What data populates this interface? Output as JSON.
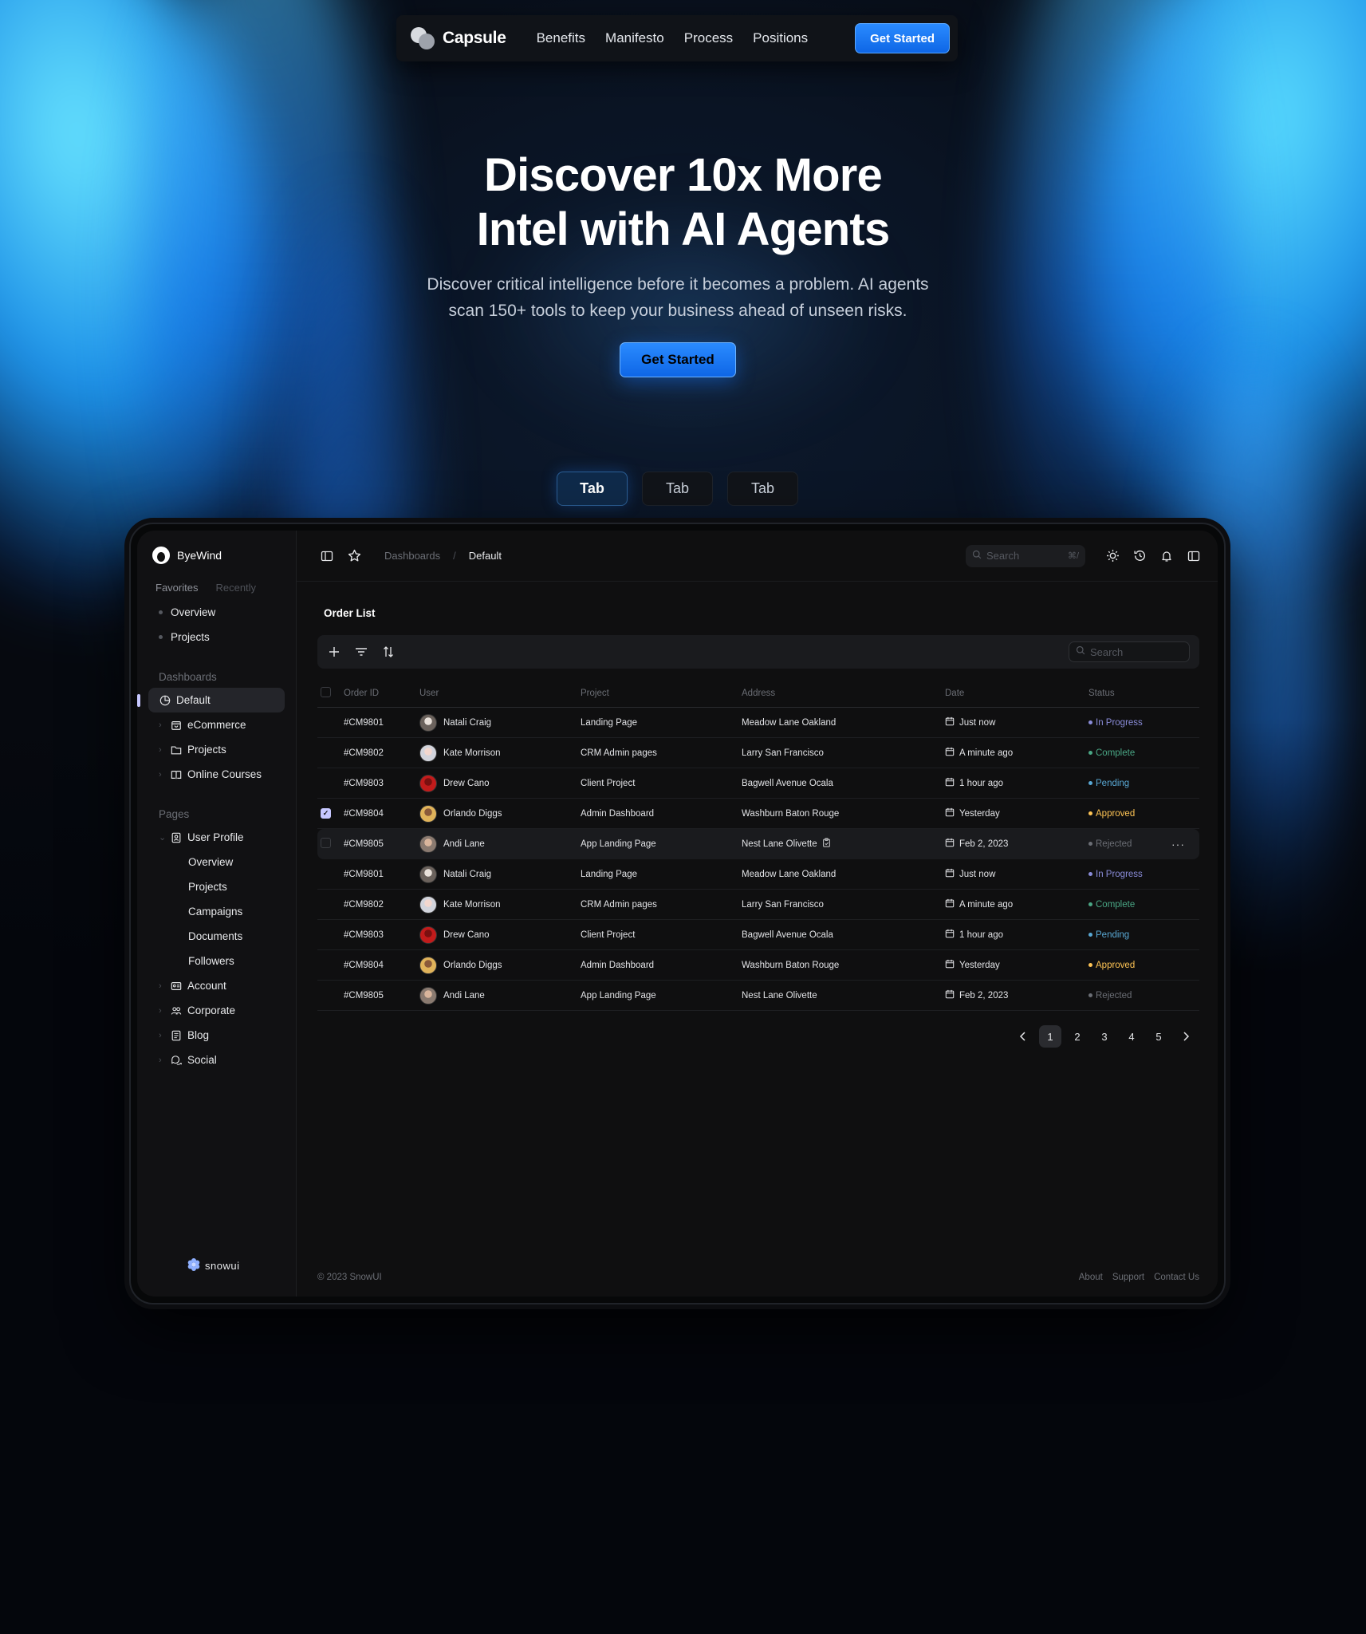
{
  "nav": {
    "brand": "Capsule",
    "links": [
      "Benefits",
      "Manifesto",
      "Process",
      "Positions"
    ],
    "cta": "Get Started"
  },
  "hero": {
    "title_line1": "Discover 10x More",
    "title_line2": "Intel with AI Agents",
    "subtitle_line1": "Discover critical intelligence before it becomes a problem. AI agents",
    "subtitle_line2": "scan 150+ tools to keep your business ahead of unseen risks.",
    "cta": "Get Started"
  },
  "tabs": [
    "Tab",
    "Tab",
    "Tab"
  ],
  "app": {
    "sidebar": {
      "brand": "ByeWind",
      "fav_tabs": [
        "Favorites",
        "Recently"
      ],
      "favorites": [
        "Overview",
        "Projects"
      ],
      "dashboards_title": "Dashboards",
      "dashboards": [
        "Default",
        "eCommerce",
        "Projects",
        "Online Courses"
      ],
      "pages_title": "Pages",
      "user_profile": "User Profile",
      "user_profile_sub": [
        "Overview",
        "Projects",
        "Campaigns",
        "Documents",
        "Followers"
      ],
      "pages": [
        "Account",
        "Corporate",
        "Blog",
        "Social"
      ],
      "footer_logo": "snowui"
    },
    "topbar": {
      "breadcrumb_root": "Dashboards",
      "breadcrumb_sep": "/",
      "breadcrumb_current": "Default",
      "search_placeholder": "Search",
      "search_shortcut": "⌘/"
    },
    "order_list": {
      "title": "Order List",
      "search_placeholder": "Search",
      "columns": [
        "Order ID",
        "User",
        "Project",
        "Address",
        "Date",
        "Status"
      ],
      "rows": [
        {
          "id": "#CM9801",
          "user": "Natali Craig",
          "project": "Landing Page",
          "address": "Meadow Lane Oakland",
          "date": "Just now",
          "status": "In Progress",
          "checked": false
        },
        {
          "id": "#CM9802",
          "user": "Kate Morrison",
          "project": "CRM Admin pages",
          "address": "Larry San Francisco",
          "date": "A minute ago",
          "status": "Complete",
          "checked": false
        },
        {
          "id": "#CM9803",
          "user": "Drew Cano",
          "project": "Client Project",
          "address": "Bagwell Avenue Ocala",
          "date": "1 hour ago",
          "status": "Pending",
          "checked": false
        },
        {
          "id": "#CM9804",
          "user": "Orlando Diggs",
          "project": "Admin Dashboard",
          "address": "Washburn Baton Rouge",
          "date": "Yesterday",
          "status": "Approved",
          "checked": true
        },
        {
          "id": "#CM9805",
          "user": "Andi Lane",
          "project": "App Landing Page",
          "address": "Nest Lane Olivette",
          "date": "Feb 2, 2023",
          "status": "Rejected",
          "checked": false
        },
        {
          "id": "#CM9801",
          "user": "Natali Craig",
          "project": "Landing Page",
          "address": "Meadow Lane Oakland",
          "date": "Just now",
          "status": "In Progress",
          "checked": false
        },
        {
          "id": "#CM9802",
          "user": "Kate Morrison",
          "project": "CRM Admin pages",
          "address": "Larry San Francisco",
          "date": "A minute ago",
          "status": "Complete",
          "checked": false
        },
        {
          "id": "#CM9803",
          "user": "Drew Cano",
          "project": "Client Project",
          "address": "Bagwell Avenue Ocala",
          "date": "1 hour ago",
          "status": "Pending",
          "checked": false
        },
        {
          "id": "#CM9804",
          "user": "Orlando Diggs",
          "project": "Admin Dashboard",
          "address": "Washburn Baton Rouge",
          "date": "Yesterday",
          "status": "Approved",
          "checked": false
        },
        {
          "id": "#CM9805",
          "user": "Andi Lane",
          "project": "App Landing Page",
          "address": "Nest Lane Olivette",
          "date": "Feb 2, 2023",
          "status": "Rejected",
          "checked": false
        }
      ],
      "status_colors": {
        "In Progress": "#8a8cd9",
        "Complete": "#4aa785",
        "Pending": "#59a8d4",
        "Approved": "#ffc555",
        "Rejected": "#6b6e75"
      },
      "pages": [
        "1",
        "2",
        "3",
        "4",
        "5"
      ],
      "current_page": "1"
    },
    "footer": {
      "copyright": "© 2023 SnowUI",
      "links": [
        "About",
        "Support",
        "Contact Us"
      ]
    }
  },
  "colors": {
    "accent_blue": "#1a7bff",
    "active_indicator": "#c6c7ff"
  }
}
